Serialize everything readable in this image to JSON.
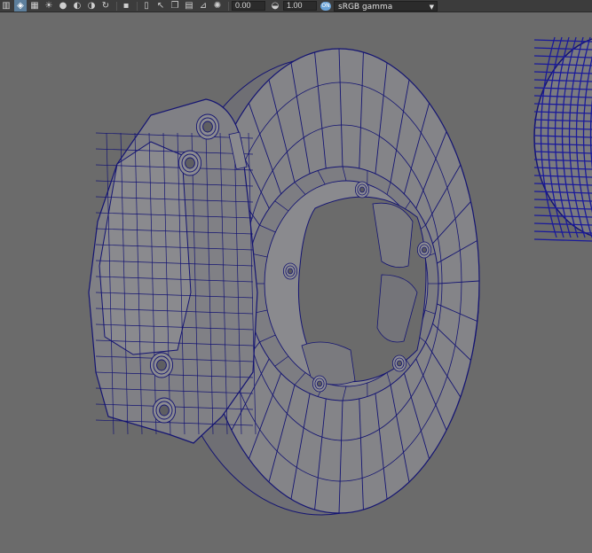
{
  "toolbar": {
    "icons": [
      {
        "name": "grid-toggle-icon",
        "glyph": "▥",
        "active": false
      },
      {
        "name": "wireframe-shaded-icon",
        "glyph": "◈",
        "active": true
      },
      {
        "name": "checker-texture-icon",
        "glyph": "▦",
        "active": false
      },
      {
        "name": "lighting-icon",
        "glyph": "☀",
        "active": false
      },
      {
        "name": "color-balls-icon",
        "glyph": "●",
        "active": false
      },
      {
        "name": "shadow-icon",
        "glyph": "◐",
        "active": false
      },
      {
        "name": "ambient-occlusion-icon",
        "glyph": "◑",
        "active": false
      },
      {
        "name": "refresh-icon",
        "glyph": "↻",
        "active": false
      },
      {
        "name": "isolate-icon",
        "glyph": "▪",
        "active": false
      },
      {
        "name": "select-icon",
        "glyph": "▯",
        "active": false
      },
      {
        "name": "cursor-icon",
        "glyph": "↖",
        "active": false
      },
      {
        "name": "duplicate-icon",
        "glyph": "❐",
        "active": false
      },
      {
        "name": "xray-icon",
        "glyph": "▤",
        "active": false
      },
      {
        "name": "graph-icon",
        "glyph": "⊿",
        "active": false
      },
      {
        "name": "camera-aperture-icon",
        "glyph": "✺",
        "active": false
      }
    ],
    "exposure_value": "0.00",
    "gamma_value": "1.00",
    "color_management_badge": "ON",
    "color_space": "sRGB gamma"
  },
  "colors": {
    "background": "#6b6b6b",
    "mesh_fill": "#848488",
    "mesh_fill_dark": "#6f6f74",
    "wire": "#141472"
  }
}
